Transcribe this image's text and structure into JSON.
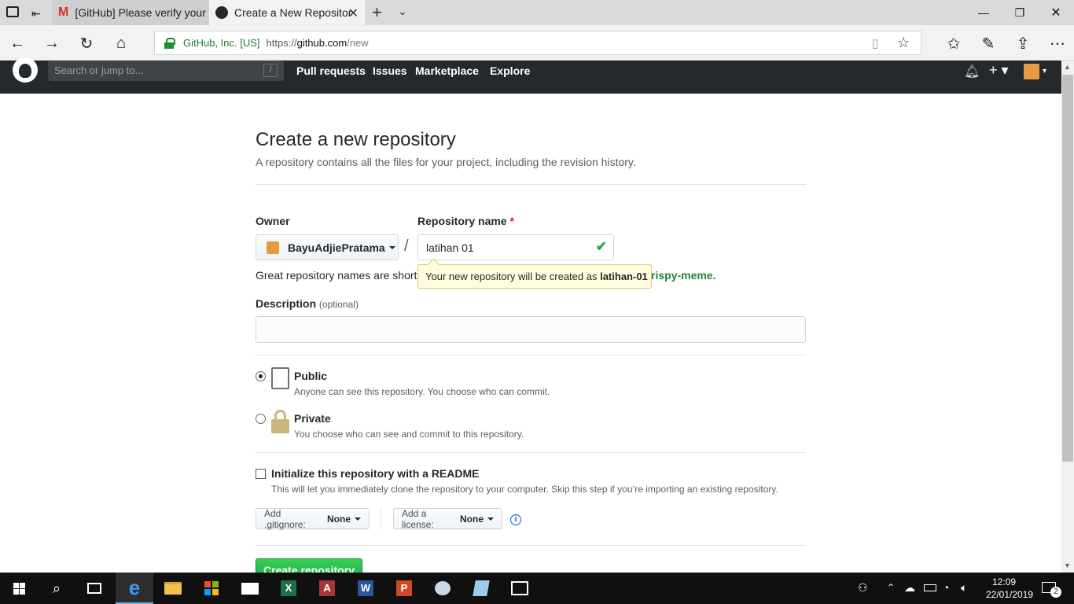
{
  "browser": {
    "tabs": [
      {
        "title": "[GitHub] Please verify your e",
        "active": false
      },
      {
        "title": "Create a New Repositor",
        "active": true
      }
    ],
    "address": {
      "org": "GitHub, Inc. [US]",
      "scheme": "https://",
      "host": "github.com",
      "path": "/new"
    }
  },
  "github": {
    "search_placeholder": "Search or jump to...",
    "search_shortcut": "/",
    "nav": [
      "Pull requests",
      "Issues",
      "Marketplace",
      "Explore"
    ]
  },
  "page": {
    "title": "Create a new repository",
    "subtitle": "A repository contains all the files for your project, including the revision history.",
    "owner_label": "Owner",
    "owner_value": "BayuAdjiePratama",
    "separator": "/",
    "repo_label": "Repository name",
    "required_mark": "*",
    "repo_value": "latihan 01",
    "hint_prefix": "Great repository names are short",
    "hint_suffix": "rispy-meme.",
    "tooltip_prefix": "Your new repository will be created as",
    "tooltip_name": "latihan-01",
    "description_label": "Description",
    "description_optional": "(optional)",
    "description_value": "",
    "visibility": [
      {
        "label": "Public",
        "note": "Anyone can see this repository. You choose who can commit.",
        "checked": true
      },
      {
        "label": "Private",
        "note": "You choose who can see and commit to this repository.",
        "checked": false
      }
    ],
    "readme_label": "Initialize this repository with a README",
    "readme_note": "This will let you immediately clone the repository to your computer. Skip this step if you’re importing an existing repository.",
    "gitignore_label": "Add .gitignore:",
    "gitignore_value": "None",
    "license_label": "Add a license:",
    "license_value": "None",
    "create_button": "Create repository"
  },
  "taskbar": {
    "time": "12:09",
    "date": "22/01/2019",
    "notifications": "2"
  },
  "colors": {
    "github_header": "#24292e",
    "create_button": "#28a745",
    "tooltip_bg": "#fffbdd",
    "secure_green": "#1e7b2e"
  }
}
